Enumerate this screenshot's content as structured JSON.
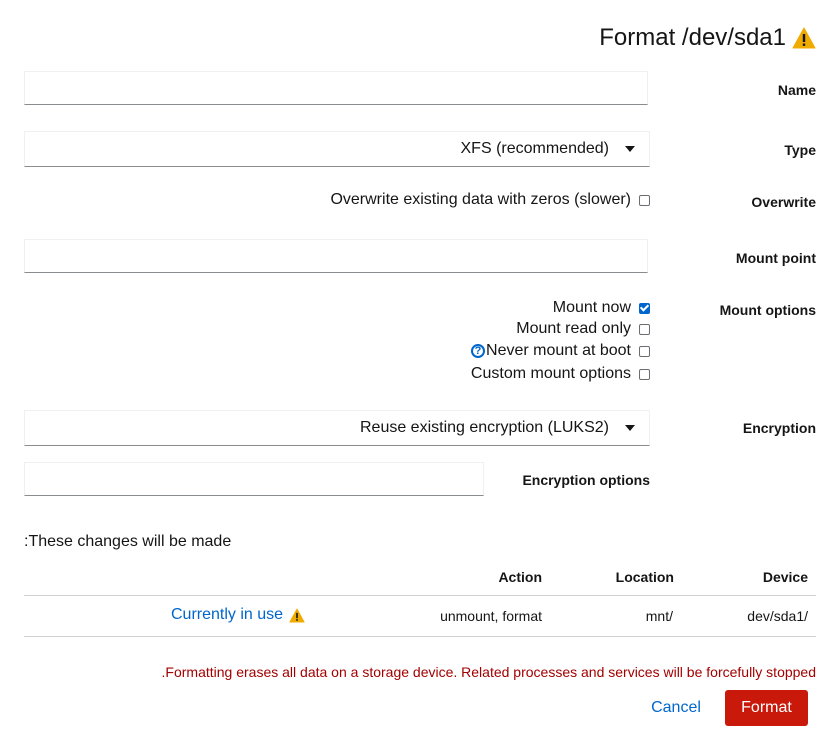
{
  "dialog": {
    "title": "Format /dev/sda1"
  },
  "fields": {
    "name_label": "Name",
    "name_value": "",
    "type_label": "Type",
    "type_value": "XFS (recommended)",
    "overwrite_label": "Overwrite",
    "overwrite_text": "Overwrite existing data with zeros (slower)",
    "overwrite_checked": false,
    "mount_point_label": "Mount point",
    "mount_point_value": "",
    "mount_options_label": "Mount options",
    "mount_options": [
      {
        "label": "Mount now",
        "checked": true
      },
      {
        "label": "Mount read only",
        "checked": false
      },
      {
        "label": "Never mount at boot",
        "checked": false
      },
      {
        "label": "Custom mount options",
        "checked": false
      }
    ],
    "encryption_label": "Encryption",
    "encryption_value": "Reuse existing encryption (LUKS2)",
    "encryption_options_label": "Encryption options",
    "encryption_options_value": ""
  },
  "changes": {
    "heading": ":These changes will be made",
    "columns": [
      "Action",
      "Location",
      "Device"
    ],
    "rows": [
      {
        "status": "Currently in use",
        "action": "unmount, format",
        "location": "mnt/",
        "device": "dev/sda1/"
      }
    ]
  },
  "warning_text": ".Formatting erases all data on a storage device. Related processes and services will be forcefully stopped",
  "buttons": {
    "cancel": "Cancel",
    "format": "Format"
  },
  "colors": {
    "accent": "#0066cc",
    "danger": "#c9190b",
    "warning": "#f0ab00"
  }
}
